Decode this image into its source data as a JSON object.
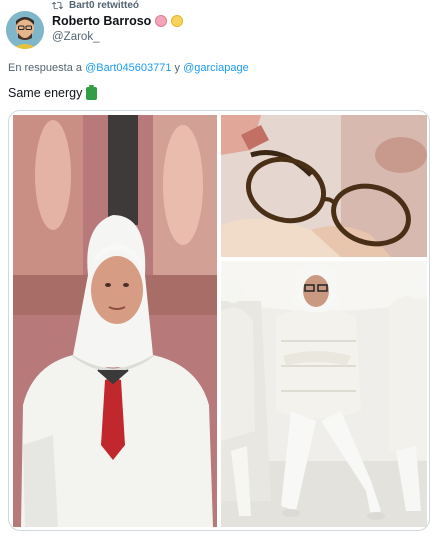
{
  "retweet": {
    "label": "Bart0 retwitteó",
    "icon": "retweet-icon"
  },
  "author": {
    "name": "Roberto Barroso",
    "handle": "@Zarok_",
    "emojis": [
      "brain-emoji",
      "sun-emoji"
    ]
  },
  "reply": {
    "prefix": "En respuesta a",
    "mention1": "@Bart045603771",
    "connector": "y",
    "mention2": "@garciapage"
  },
  "tweet": {
    "text": "Same energy",
    "emoji": "battery-icon"
  },
  "media": {
    "images": [
      {
        "name": "man-in-white-protective-suit-photo"
      },
      {
        "name": "eyeglasses-cleaning-photo"
      },
      {
        "name": "people-in-white-padded-suits-photo"
      }
    ]
  },
  "colors": {
    "link": "#1d9bf0",
    "secondary_text": "#536471",
    "border": "#cfd9de"
  }
}
